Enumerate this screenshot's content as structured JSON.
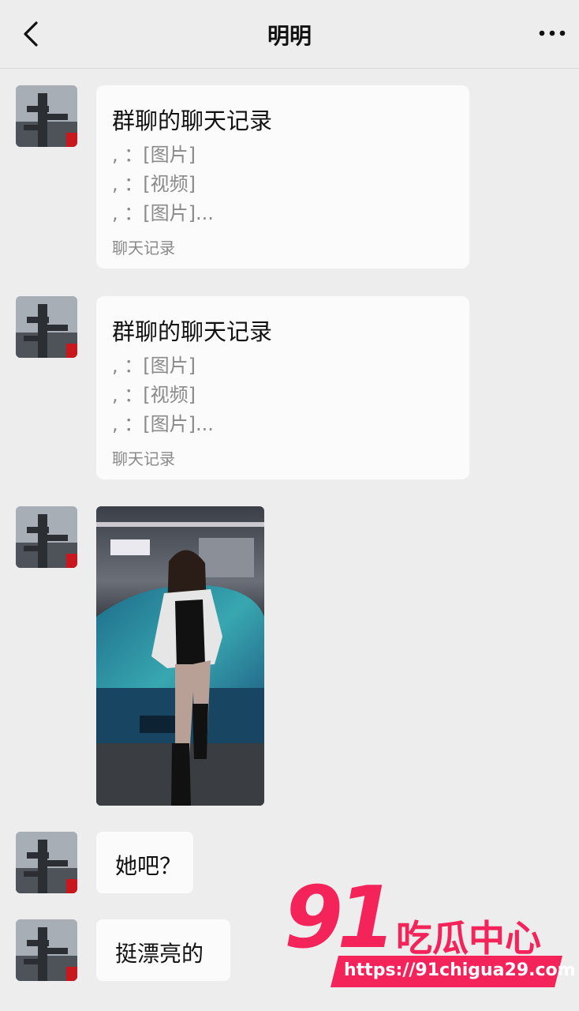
{
  "header": {
    "title": "明明"
  },
  "messages": {
    "record1": {
      "title": "群聊的聊天记录",
      "lines": [
        ", ：[图片]",
        ", ：[视频]",
        ", ：[图片]..."
      ],
      "footer": "聊天记录"
    },
    "record2": {
      "title": "群聊的聊天记录",
      "lines": [
        ", ：[图片]",
        ", ：[视频]",
        ", ：[图片]..."
      ],
      "footer": "聊天记录"
    },
    "text1": "她吧？",
    "text2": "挺漂亮的"
  },
  "watermark": {
    "number": "91",
    "brand": "吃瓜中心",
    "url": "https://91chigua29.com"
  },
  "colors": {
    "background": "#ededed",
    "bubble": "#fbfbfb",
    "watermark": "#f4245b"
  }
}
